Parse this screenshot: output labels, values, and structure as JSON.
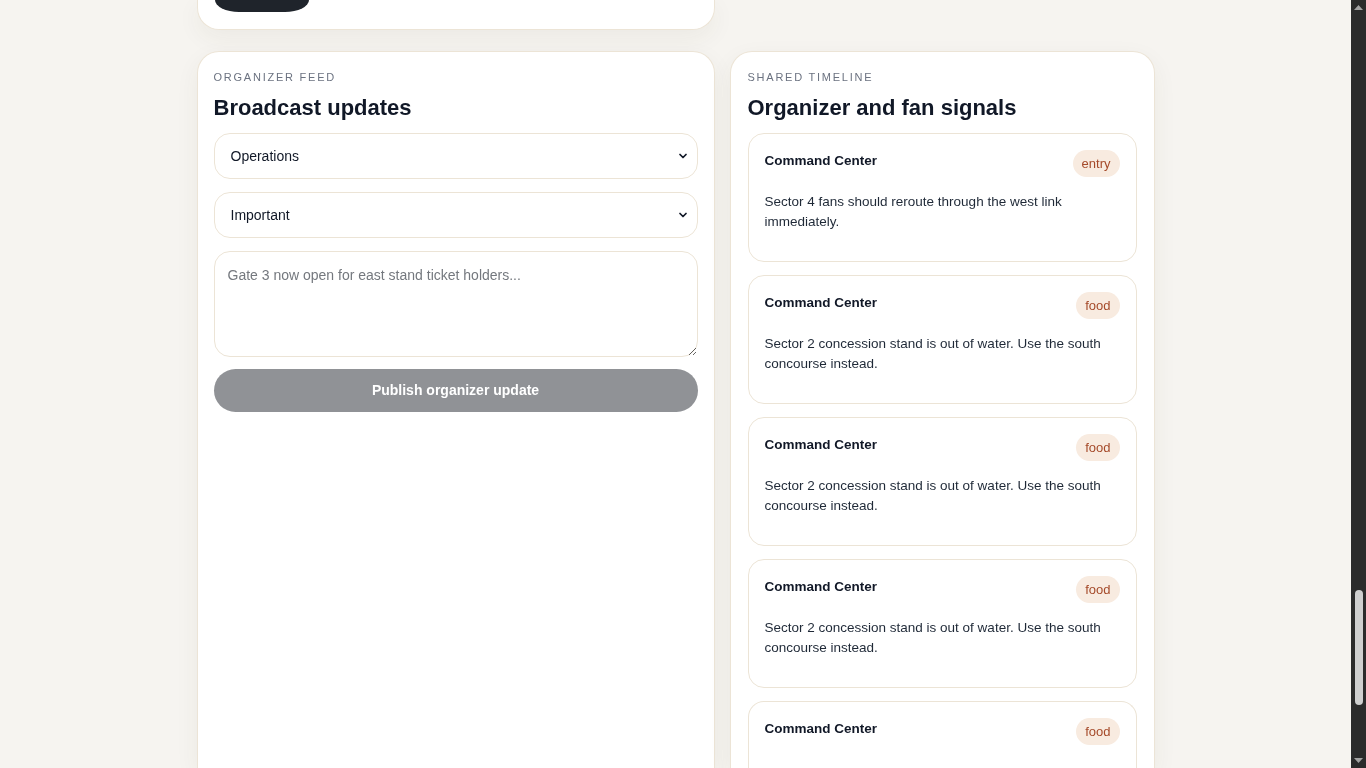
{
  "organizer_feed": {
    "eyebrow": "ORGANIZER FEED",
    "title": "Broadcast updates",
    "selects": [
      {
        "value": "Operations"
      },
      {
        "value": "Important"
      }
    ],
    "message": {
      "placeholder": "Gate 3 now open for east stand ticket holders..."
    },
    "publish_button": {
      "label": "Publish organizer update",
      "disabled": true
    }
  },
  "shared_timeline": {
    "eyebrow": "SHARED TIMELINE",
    "title": "Organizer and fan signals",
    "signals": [
      {
        "author": "Command Center",
        "tag": "entry",
        "message": "Sector 4 fans should reroute through the west link immediately."
      },
      {
        "author": "Command Center",
        "tag": "food",
        "message": "Sector 2 concession stand is out of water. Use the south concourse instead."
      },
      {
        "author": "Command Center",
        "tag": "food",
        "message": "Sector 2 concession stand is out of water. Use the south concourse instead."
      },
      {
        "author": "Command Center",
        "tag": "food",
        "message": "Sector 2 concession stand is out of water. Use the south concourse instead."
      },
      {
        "author": "Command Center",
        "tag": "food"
      }
    ]
  }
}
